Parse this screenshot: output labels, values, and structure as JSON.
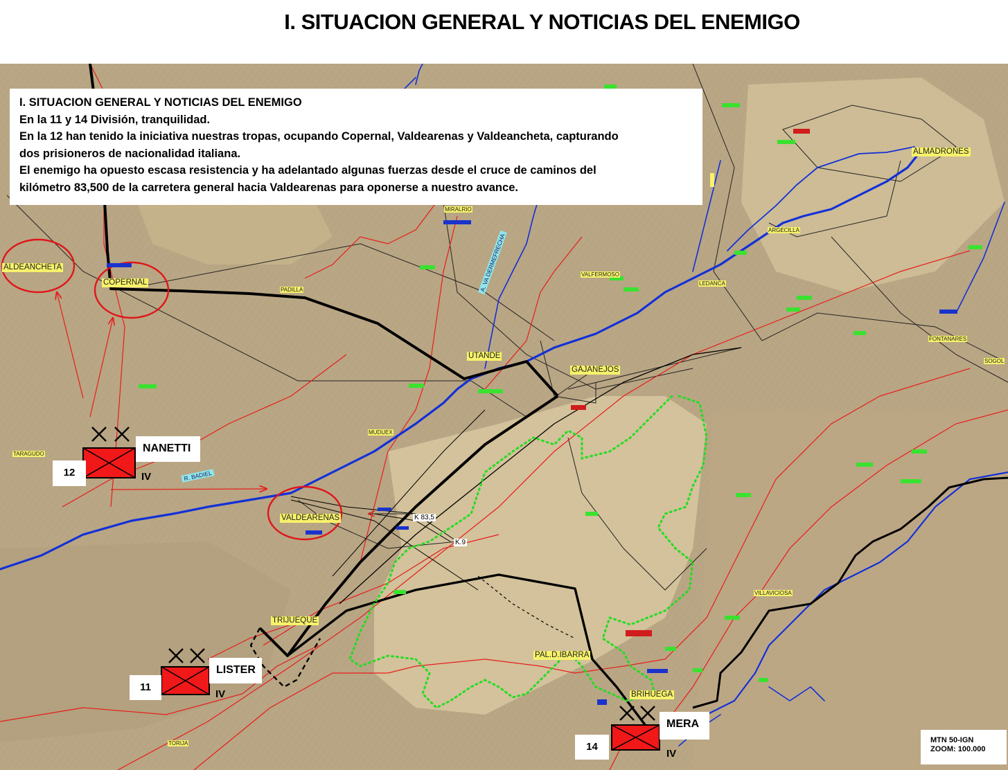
{
  "title": "I. SITUACION GENERAL Y NOTICIAS DEL ENEMIGO",
  "report": {
    "heading": "I. SITUACION GENERAL Y NOTICIAS DEL ENEMIGO",
    "lines": [
      "En la 11 y 14 División, tranquilidad.",
      "En la 12 han tenido la iniciativa nuestras tropas, ocupando Copernal, Valdearenas y Valdeancheta, capturando",
      "dos prisioneros de nacionalidad italiana.",
      "El enemigo ha opuesto escasa resistencia y ha adelantado algunas fuerzas desde el cruce de caminos del",
      "kilómetro 83,500 de la carretera general hacia Valdearenas para oponerse a nuestro avance."
    ]
  },
  "places": {
    "aldeancheta": "ALDEANCHETA",
    "copernal": "COPERNAL",
    "padilla": "PADILLA",
    "utande": "UTANDE",
    "gajanejos": "GAJANEJOS",
    "almadrones": "ALMADRONES",
    "argecilla": "ARGECILLA",
    "ledanca": "LEDANCA",
    "valfermoso": "VALFERMOSO",
    "miralrio": "MIRALRIO",
    "mudujex": "MUDUEX",
    "taragudo": "TARAGUDO",
    "valdearenas": "VALDEARENAS",
    "trijueque": "TRIJUEQUE",
    "pal_ibarra": "PAL.D.IBARRA",
    "brihuega": "BRIHUEGA",
    "villaviciosa": "VILLAVICIOSA",
    "fontanares": "FONTANARES",
    "sogol": "SOGOL",
    "torija": "TORIJA"
  },
  "rivers": {
    "badiel": "R. BADIEL",
    "dermefrecha": "A. VA DERMEFRECHA"
  },
  "roads": {
    "k835": "K 83,5",
    "k9": "K.9"
  },
  "units": [
    {
      "name": "NANETTI",
      "number": "12",
      "size": "IV"
    },
    {
      "name": "LISTER",
      "number": "11",
      "size": "IV"
    },
    {
      "name": "MERA",
      "number": "14",
      "size": "IV"
    }
  ],
  "scale": {
    "line1": "MTN 50-IGN",
    "line2": "ZOOM: 100.000"
  },
  "colors": {
    "terrain": "#b9a684",
    "terrain_light": "#d4c39b",
    "river": "#1230d8",
    "road": "#e81c1c",
    "front": "#000000",
    "objective": "#e0161a",
    "zone": "#22dd22",
    "unit_fill": "#f01818",
    "label": "#f7f26a"
  },
  "icons": {
    "unit": "infantry-division-symbol",
    "objective": "red-ellipse-marker",
    "advance": "red-arrow"
  }
}
